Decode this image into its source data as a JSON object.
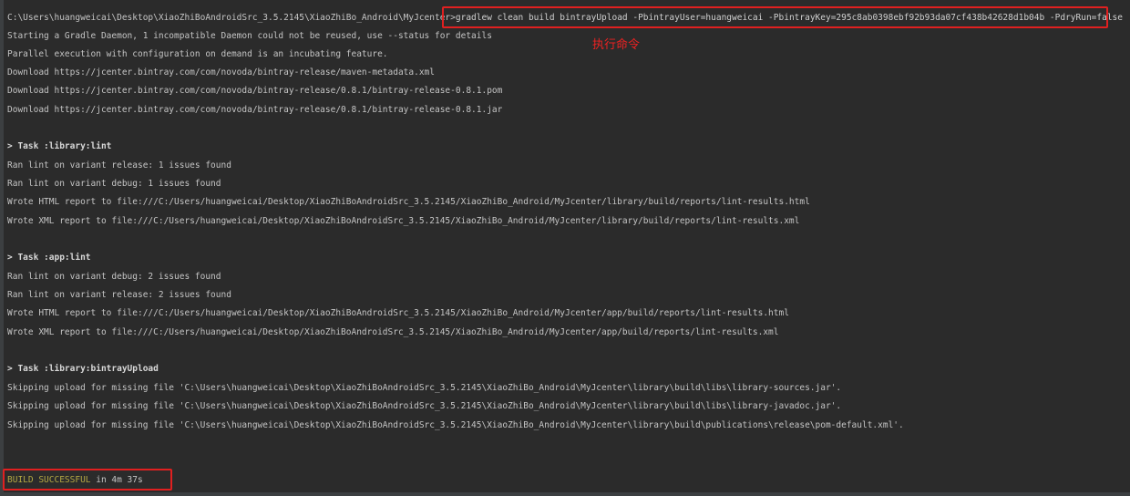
{
  "command_line": {
    "prompt": "C:\\Users\\huangweicai\\Desktop\\XiaoZhiBoAndroidSrc_3.5.2145\\XiaoZhiBo_Android\\MyJcenter>",
    "command": "gradlew clean build bintrayUpload -PbintrayUser=huangweicai -PbintrayKey=295c8ab0398ebf92b93da07cf438b42628d1b04b -PdryRun=false"
  },
  "annotation": {
    "text": "执行命令",
    "color": "#ee2222"
  },
  "startup_lines": [
    "Starting a Gradle Daemon, 1 incompatible Daemon could not be reused, use --status for details",
    "Parallel execution with configuration on demand is an incubating feature.",
    "Download https://jcenter.bintray.com/com/novoda/bintray-release/maven-metadata.xml",
    "Download https://jcenter.bintray.com/com/novoda/bintray-release/0.8.1/bintray-release-0.8.1.pom",
    "Download https://jcenter.bintray.com/com/novoda/bintray-release/0.8.1/bintray-release-0.8.1.jar"
  ],
  "tasks": [
    {
      "header": "> Task :library:lint",
      "lines": [
        "Ran lint on variant release: 1 issues found",
        "Ran lint on variant debug: 1 issues found",
        "Wrote HTML report to file:///C:/Users/huangweicai/Desktop/XiaoZhiBoAndroidSrc_3.5.2145/XiaoZhiBo_Android/MyJcenter/library/build/reports/lint-results.html",
        "Wrote XML report to file:///C:/Users/huangweicai/Desktop/XiaoZhiBoAndroidSrc_3.5.2145/XiaoZhiBo_Android/MyJcenter/library/build/reports/lint-results.xml"
      ]
    },
    {
      "header": "> Task :app:lint",
      "lines": [
        "Ran lint on variant debug: 2 issues found",
        "Ran lint on variant release: 2 issues found",
        "Wrote HTML report to file:///C:/Users/huangweicai/Desktop/XiaoZhiBoAndroidSrc_3.5.2145/XiaoZhiBo_Android/MyJcenter/app/build/reports/lint-results.html",
        "Wrote XML report to file:///C:/Users/huangweicai/Desktop/XiaoZhiBoAndroidSrc_3.5.2145/XiaoZhiBo_Android/MyJcenter/app/build/reports/lint-results.xml"
      ]
    },
    {
      "header": "> Task :library:bintrayUpload",
      "lines": [
        "Skipping upload for missing file 'C:\\Users\\huangweicai\\Desktop\\XiaoZhiBoAndroidSrc_3.5.2145\\XiaoZhiBo_Android\\MyJcenter\\library\\build\\libs\\library-sources.jar'.",
        "Skipping upload for missing file 'C:\\Users\\huangweicai\\Desktop\\XiaoZhiBoAndroidSrc_3.5.2145\\XiaoZhiBo_Android\\MyJcenter\\library\\build\\libs\\library-javadoc.jar'.",
        "Skipping upload for missing file 'C:\\Users\\huangweicai\\Desktop\\XiaoZhiBoAndroidSrc_3.5.2145\\XiaoZhiBo_Android\\MyJcenter\\library\\build\\publications\\release\\pom-default.xml'."
      ]
    }
  ],
  "result": {
    "status": "BUILD SUCCESSFUL",
    "duration": " in 4m 37s"
  },
  "colors": {
    "background": "#2b2b2b",
    "text": "#c5c5c5",
    "success": "#b5a843",
    "highlight": "#e02020"
  }
}
